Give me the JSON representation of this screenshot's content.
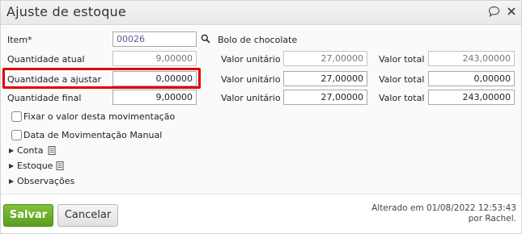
{
  "dialog": {
    "title": "Ajuste de estoque",
    "icons": {
      "comment": "comment-icon",
      "close": "close-icon"
    }
  },
  "form": {
    "item": {
      "label": "Item*",
      "code": "00026",
      "description": "Bolo de chocolate"
    },
    "rows": {
      "atual": {
        "label": "Quantidade atual",
        "quantity": "9,00000",
        "unit_label": "Valor unitário",
        "unit_value": "27,00000",
        "total_label": "Valor total",
        "total_value": "243,00000"
      },
      "ajustar": {
        "label": "Quantidade a ajustar",
        "quantity": "0,00000",
        "unit_label": "Valor unitário",
        "unit_value": "27,00000",
        "total_label": "Valor total",
        "total_value": "0,00000"
      },
      "final": {
        "label": "Quantidade final",
        "quantity": "9,00000",
        "unit_label": "Valor unitário",
        "unit_value": "27,00000",
        "total_label": "Valor total",
        "total_value": "243,00000"
      }
    },
    "checkboxes": {
      "fixar": "Fixar o valor desta movimentação",
      "data_manual": "Data de Movimentação Manual"
    },
    "sections": {
      "conta": "Conta",
      "estoque": "Estoque",
      "observacoes": "Observações"
    }
  },
  "footer": {
    "save_label": "Salvar",
    "cancel_label": "Cancelar",
    "audit_line1": "Alterado em 01/08/2022 12:53:43",
    "audit_line2": "por Rachel."
  },
  "colors": {
    "highlight": "#e00000",
    "save_button": "#6aaa2b"
  }
}
